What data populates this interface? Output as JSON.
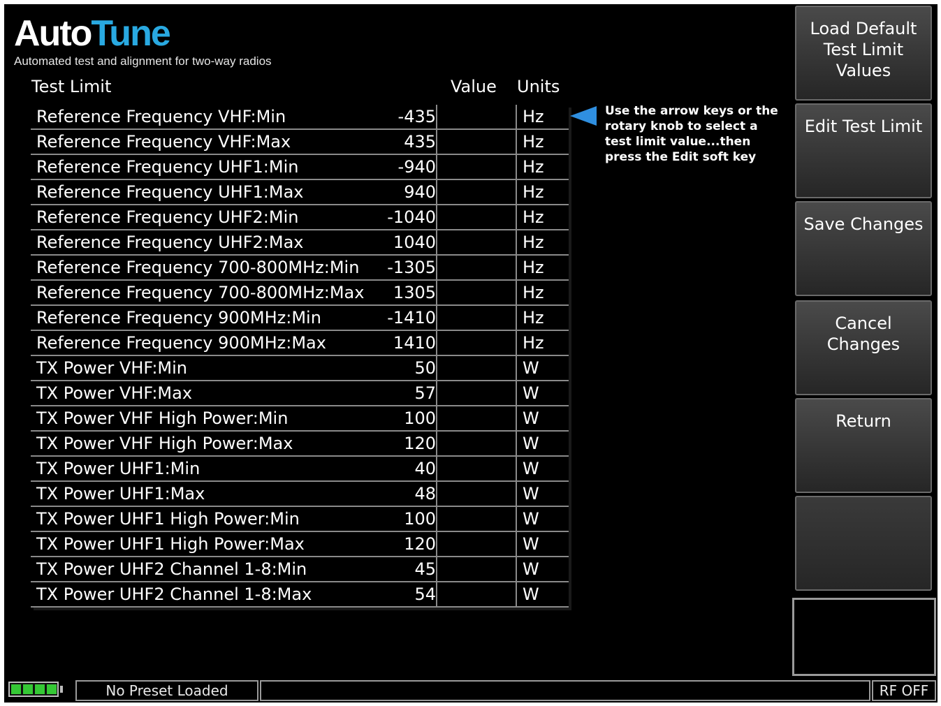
{
  "logo": {
    "word_part1": "Auto",
    "word_part2": "Tune",
    "tagline": "Automated test and alignment for two-way radios"
  },
  "table": {
    "headers": {
      "name": "Test Limit",
      "value": "Value",
      "units": "Units"
    },
    "rows": [
      {
        "name": "Reference Frequency VHF:Min",
        "value": "-435",
        "unit": "Hz"
      },
      {
        "name": "Reference Frequency VHF:Max",
        "value": "435",
        "unit": "Hz"
      },
      {
        "name": "Reference Frequency UHF1:Min",
        "value": "-940",
        "unit": "Hz"
      },
      {
        "name": "Reference Frequency UHF1:Max",
        "value": "940",
        "unit": "Hz"
      },
      {
        "name": "Reference Frequency UHF2:Min",
        "value": "-1040",
        "unit": "Hz"
      },
      {
        "name": "Reference Frequency UHF2:Max",
        "value": "1040",
        "unit": "Hz"
      },
      {
        "name": "Reference Frequency 700-800MHz:Min",
        "value": "-1305",
        "unit": "Hz"
      },
      {
        "name": "Reference Frequency 700-800MHz:Max",
        "value": "1305",
        "unit": "Hz"
      },
      {
        "name": "Reference Frequency 900MHz:Min",
        "value": "-1410",
        "unit": "Hz"
      },
      {
        "name": "Reference Frequency 900MHz:Max",
        "value": "1410",
        "unit": "Hz"
      },
      {
        "name": "TX Power VHF:Min",
        "value": "50",
        "unit": "W"
      },
      {
        "name": "TX Power VHF:Max",
        "value": "57",
        "unit": "W"
      },
      {
        "name": "TX Power VHF High Power:Min",
        "value": "100",
        "unit": "W"
      },
      {
        "name": "TX Power VHF High Power:Max",
        "value": "120",
        "unit": "W"
      },
      {
        "name": "TX Power UHF1:Min",
        "value": "40",
        "unit": "W"
      },
      {
        "name": "TX Power UHF1:Max",
        "value": "48",
        "unit": "W"
      },
      {
        "name": "TX Power UHF1 High Power:Min",
        "value": "100",
        "unit": "W"
      },
      {
        "name": "TX Power UHF1 High Power:Max",
        "value": "120",
        "unit": "W"
      },
      {
        "name": "TX Power UHF2 Channel 1-8:Min",
        "value": "45",
        "unit": "W"
      },
      {
        "name": "TX Power UHF2 Channel 1-8:Max",
        "value": "54",
        "unit": "W"
      }
    ]
  },
  "hint": {
    "text": "Use the arrow keys or the rotary knob to select a test limit value...then press the Edit soft key",
    "arrow_color": "#2f8fe0"
  },
  "softkeys": {
    "load_default": "Load Default Test Limit Values",
    "edit": "Edit Test Limit",
    "save": "Save Changes",
    "cancel": "Cancel Changes",
    "return": "Return"
  },
  "status": {
    "battery_level": 1.0,
    "preset": "No Preset Loaded",
    "rf": "RF OFF"
  },
  "colors": {
    "brand_blue": "#29a9e1",
    "battery_green": "#35c835"
  }
}
